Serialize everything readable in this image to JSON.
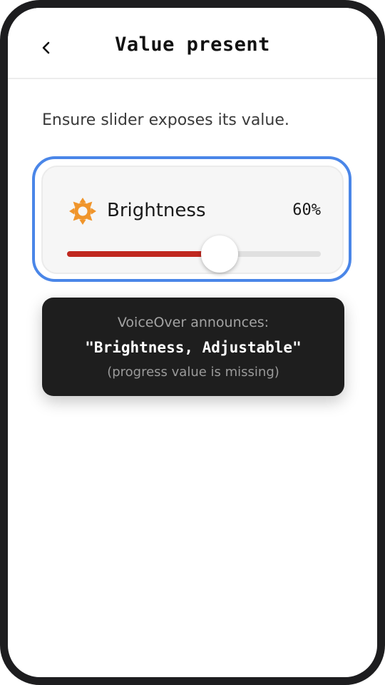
{
  "header": {
    "back_icon": "chevron-left-icon",
    "title": "Value present"
  },
  "main": {
    "description": "Ensure slider exposes its value.",
    "slider": {
      "icon": "sun-icon",
      "label": "Brightness",
      "value_text": "60%",
      "value": 0.6,
      "focused": true
    },
    "announcement": {
      "heading": "VoiceOver announces:",
      "spoken_text": "\"Brightness, Adjustable\"",
      "note": "(progress value is missing)"
    }
  },
  "colors": {
    "focus_ring": "#4a86e8",
    "slider_fill": "#c0281f",
    "slider_track": "#e0e0e0",
    "icon": "#f0952b",
    "tooltip_bg": "#1e1e1e"
  }
}
